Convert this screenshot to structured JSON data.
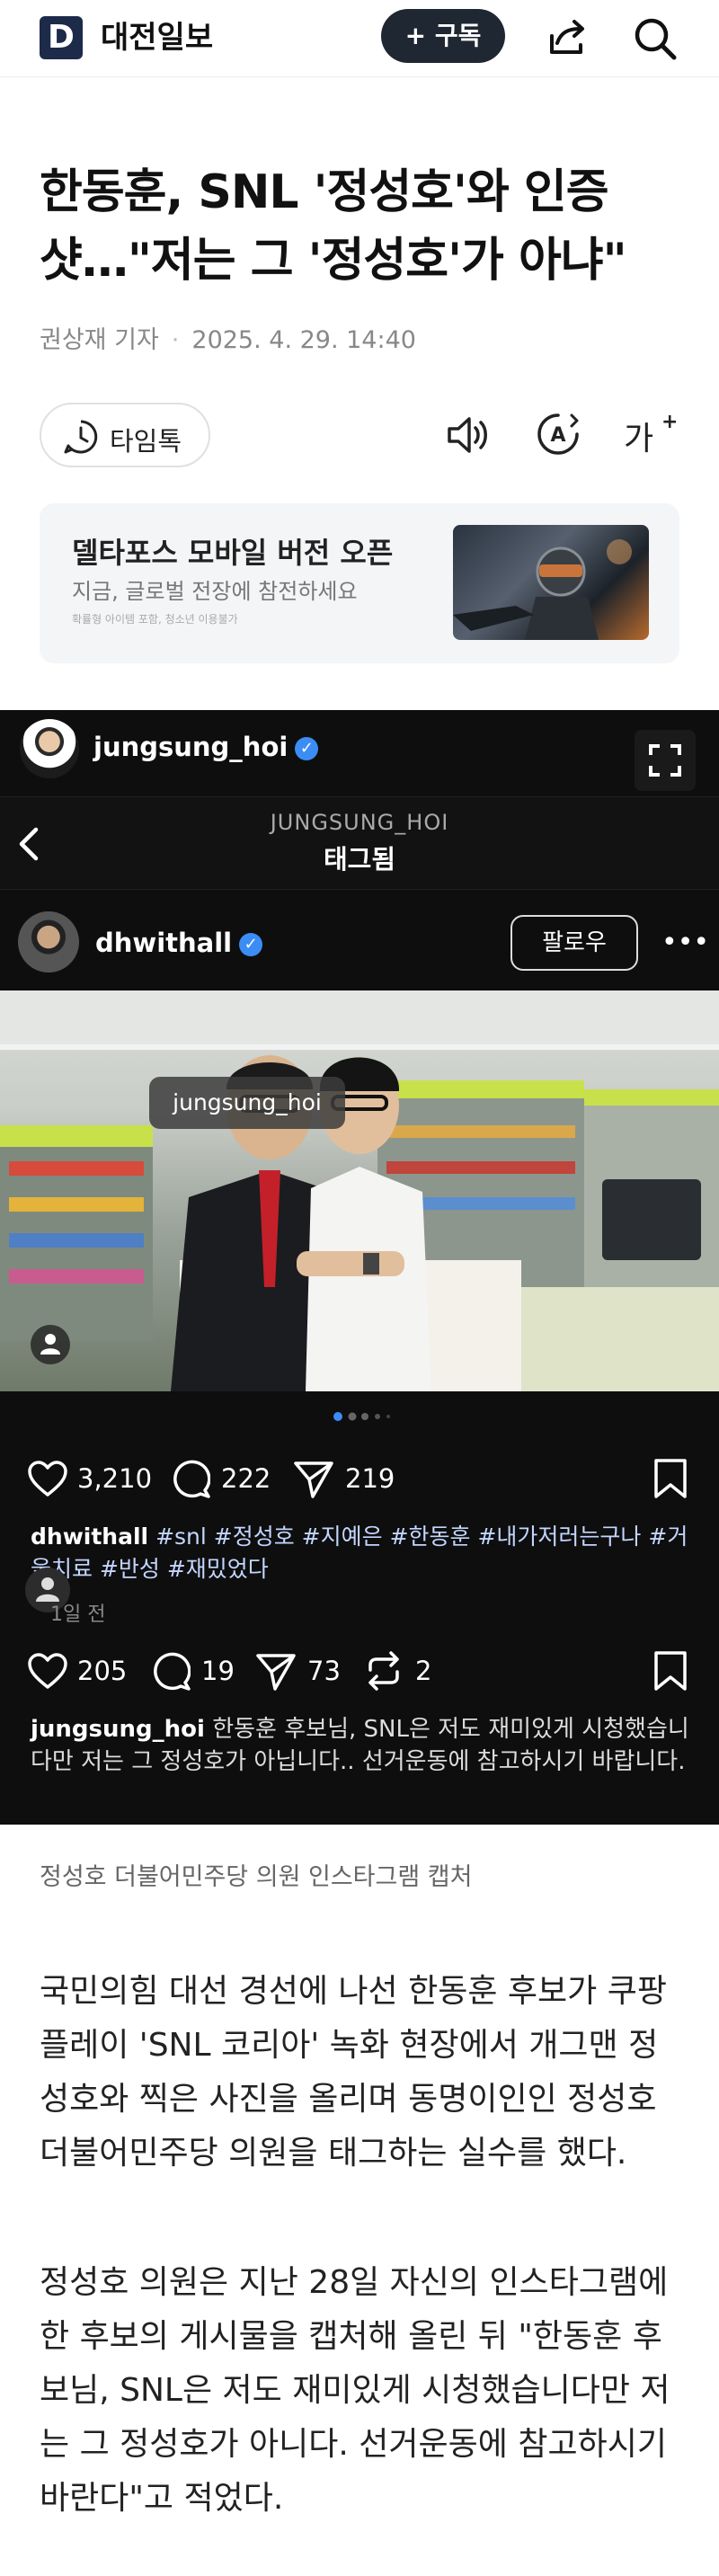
{
  "header": {
    "logo_letter": "D",
    "logo_text": "대전일보",
    "subscribe_label": "+ 구독",
    "share_icon": "share-icon",
    "search_icon": "search-icon"
  },
  "article": {
    "headline": "한동훈, SNL '정성호'와 인증샷…\"저는 그 '정성호'가 아냐\"",
    "author": "권상재 기자",
    "date": "2025. 4. 29. 14:40"
  },
  "tools": {
    "timeline_label": "타임톡",
    "speaker_icon": "speaker-icon",
    "font_icon": "font-style-icon",
    "size_icon": "text-size-icon"
  },
  "ad": {
    "title": "델타포스 모바일 버전 오픈",
    "subtitle": "지금, 글로벌 전장에 참전하세요",
    "note": "확률형 아이템 포함, 청소년 이용불가"
  },
  "instagram": {
    "user1": "jungsung_hoi",
    "tag_header_sub": "JUNGSUNG_HOI",
    "tag_header_title": "태그됨",
    "user2": "dhwithall",
    "follow_label": "팔로우",
    "photo_tag": "jungsung_hoi",
    "likes1": "3,210",
    "comments1": "222",
    "shares1": "219",
    "caption1_user": "dhwithall",
    "caption1_text": "#snl #정성호 #지예은 #한동훈 #내가저러는구나 #거울치료 #반성 #재밌었다",
    "time1": "1일 전",
    "likes2": "205",
    "comments2": "19",
    "shares2": "73",
    "reposts2": "2",
    "caption2_user": "jungsung_hoi",
    "caption2_text": "한동훈 후보님, SNL은 저도 재미있게 시청했습니다만 저는 그 정성호가 아닙니다.. 선거운동에 참고하시기 바랍니다."
  },
  "image_caption": "정성호 더불어민주당 의원 인스타그램 캡처",
  "body": {
    "p1": "국민의힘 대선 경선에 나선 한동훈 후보가 쿠팡플레이 'SNL 코리아' 녹화 현장에서 개그맨 정성호와 찍은 사진을 올리며 동명이인인 정성호 더불어민주당 의원을 태그하는 실수를 했다.",
    "p2": "정성호 의원은 지난 28일 자신의 인스타그램에 한 후보의 게시물을 캡처해 올린 뒤 \"한동훈 후보님, SNL은 저도 재미있게 시청했습니다만 저는 그 정성호가 아니다. 선거운동에 참고하시기 바란다\"고 적었다."
  },
  "colors": {
    "brand_navy": "#1d2a4a",
    "verified_blue": "#3b8df5",
    "dark_bg": "#0e0e0e"
  }
}
